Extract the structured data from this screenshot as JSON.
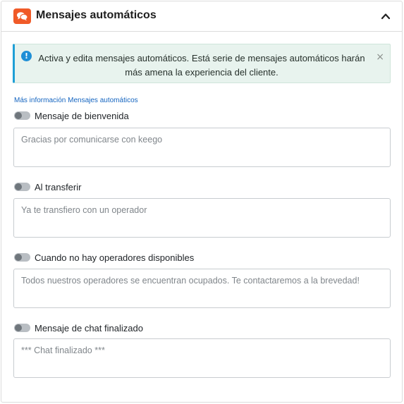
{
  "header": {
    "title": "Mensajes automáticos",
    "icon": "chat-bubbles-icon",
    "accent_color": "#f05a28"
  },
  "alert": {
    "text": "Activa y edita mensajes automáticos. Está serie de mensajes automáticos harán más amena la experiencia del cliente.",
    "close": "×"
  },
  "more_info_link": "Más información Mensajes automáticos",
  "messages": [
    {
      "label": "Mensaje de bienvenida",
      "enabled": false,
      "placeholder": "Gracias por comunicarse con keego"
    },
    {
      "label": "Al transferir",
      "enabled": false,
      "placeholder": "Ya te transfiero con un operador"
    },
    {
      "label": "Cuando no hay operadores disponibles",
      "enabled": false,
      "placeholder": "Todos nuestros operadores se encuentran ocupados. Te contactaremos a la brevedad!"
    },
    {
      "label": "Mensaje de chat finalizado",
      "enabled": false,
      "placeholder": "*** Chat finalizado ***"
    }
  ]
}
